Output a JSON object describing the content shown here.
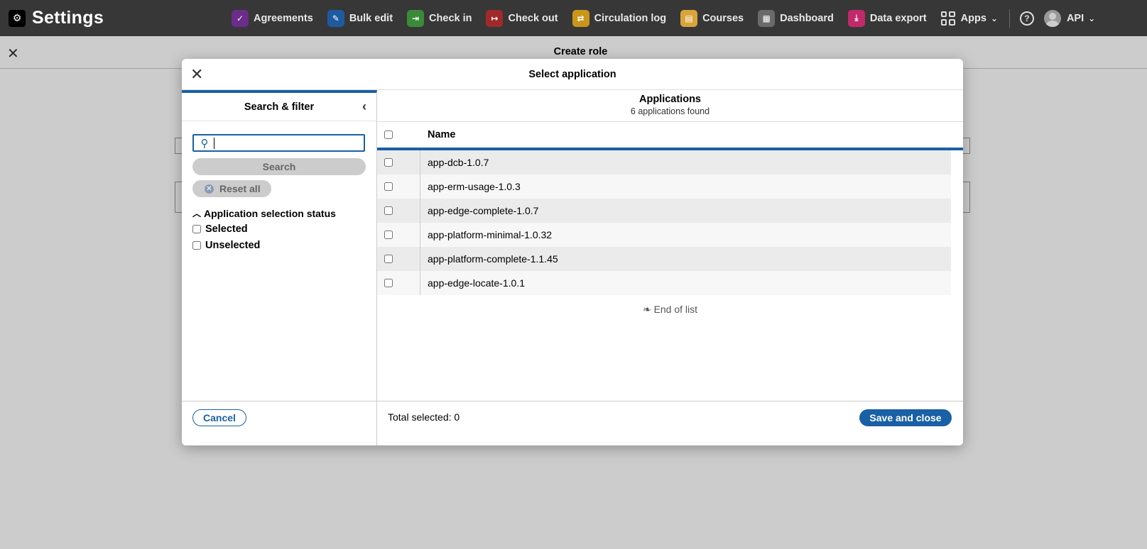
{
  "app": {
    "title": "Settings",
    "gear_icon": "gear-icon"
  },
  "nav": [
    {
      "label": "Agreements",
      "icon": "agreements-icon",
      "color": "#6b2c8a"
    },
    {
      "label": "Bulk edit",
      "icon": "bulk-edit-icon",
      "color": "#1e5aa0"
    },
    {
      "label": "Check in",
      "icon": "check-in-icon",
      "color": "#3b8a3a"
    },
    {
      "label": "Check out",
      "icon": "check-out-icon",
      "color": "#a02a2a"
    },
    {
      "label": "Circulation log",
      "icon": "circulation-log-icon",
      "color": "#c9961a"
    },
    {
      "label": "Courses",
      "icon": "courses-icon",
      "color": "#d9a43a"
    },
    {
      "label": "Dashboard",
      "icon": "dashboard-icon",
      "color": "#6a6a6a"
    },
    {
      "label": "Data export",
      "icon": "data-export-icon",
      "color": "#c02a6a"
    }
  ],
  "apps_label": "Apps",
  "user_label": "API",
  "background": {
    "title": "Create role"
  },
  "modal": {
    "title": "Select application",
    "filter": {
      "title": "Search & filter",
      "search_value": "",
      "search_button": "Search",
      "reset_button": "Reset all",
      "accordion_title": "Application selection status",
      "options": [
        {
          "label": "Selected",
          "checked": false
        },
        {
          "label": "Unselected",
          "checked": false
        }
      ]
    },
    "results": {
      "title": "Applications",
      "count": "6 applications found",
      "column_name": "Name",
      "rows": [
        "app-dcb-1.0.7",
        "app-erm-usage-1.0.3",
        "app-edge-complete-1.0.7",
        "app-platform-minimal-1.0.32",
        "app-platform-complete-1.1.45",
        "app-edge-locate-1.0.1"
      ],
      "end_of_list": "End of list"
    },
    "footer": {
      "cancel": "Cancel",
      "total_selected": "Total selected: 0",
      "save": "Save and close"
    }
  },
  "colors": {
    "accent": "#1960a4",
    "topbar": "#373737"
  }
}
